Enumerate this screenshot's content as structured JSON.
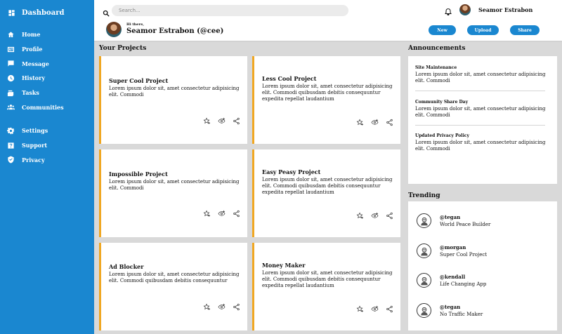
{
  "sidebar": {
    "brand": "Dashboard",
    "items": [
      {
        "label": "Home",
        "icon": "home-icon"
      },
      {
        "label": "Profile",
        "icon": "profile-card-icon"
      },
      {
        "label": "Message",
        "icon": "message-icon"
      },
      {
        "label": "History",
        "icon": "clock-icon"
      },
      {
        "label": "Tasks",
        "icon": "tasks-icon"
      },
      {
        "label": "Communities",
        "icon": "people-icon"
      }
    ],
    "secondary": [
      {
        "label": "Settings",
        "icon": "gear-icon"
      },
      {
        "label": "Support",
        "icon": "help-icon"
      },
      {
        "label": "Privacy",
        "icon": "shield-icon"
      }
    ]
  },
  "header": {
    "search_placeholder": "Search...",
    "user_name": "Seamor Estrabon",
    "greeting": "Hi there,",
    "full_name": "Seamor Estrabon (@cee)",
    "buttons": {
      "new": "New",
      "upload": "Upload",
      "share": "Share"
    }
  },
  "projects": {
    "title": "Your Projects",
    "items": [
      {
        "title": "Super Cool Project",
        "desc": "Lorem ipsum dolor sit, amet consectetur adipisicing elit. Commodi"
      },
      {
        "title": "Less Cool Project",
        "desc": "Lorem ipsum dolor sit, amet consectetur adipisicing elit. Commodi quibusdam debitis consequuntur expedita repellat laudantium"
      },
      {
        "title": "Impossible Project",
        "desc": "Lorem ipsum dolor sit, amet consectetur adipisicing elit. Commodi"
      },
      {
        "title": "Easy Peasy Project",
        "desc": "Lorem ipsum dolor sit, amet consectetur adipisicing elit. Commodi quibusdam debitis consequuntur expedita repellat laudantium"
      },
      {
        "title": "Ad Blocker",
        "desc": "Lorem ipsum dolor sit, amet consectetur adipisicing elit. Commodi quibusdam debitis consequuntur"
      },
      {
        "title": "Money Maker",
        "desc": "Lorem ipsum dolor sit, amet consectetur adipisicing elit. Commodi quibusdam debitis consequuntur expedita repellat laudantium"
      }
    ]
  },
  "announcements": {
    "title": "Announcements",
    "items": [
      {
        "title": "Site Maintenance",
        "body": "Lorem ipsum dolor sit, amet consectetur adipisicing elit. Commodi"
      },
      {
        "title": "Community Share Day",
        "body": "Lorem ipsum dolor sit, amet consectetur adipisicing elit. Commodi"
      },
      {
        "title": "Updated Privacy Policy",
        "body": "Lorem ipsum dolor sit, amet consectetur adipisicing elit. Commodi"
      }
    ]
  },
  "trending": {
    "title": "Trending",
    "items": [
      {
        "handle": "@tegan",
        "project": "World Peace Builder"
      },
      {
        "handle": "@morgan",
        "project": "Super Cool Project"
      },
      {
        "handle": "@kendall",
        "project": "Life Changing App"
      },
      {
        "handle": "@tegan",
        "project": "No Traffic Maker"
      }
    ]
  },
  "colors": {
    "sidebar": "#1a87d0",
    "accent": "#f0a722",
    "background": "#d9d9d9"
  }
}
